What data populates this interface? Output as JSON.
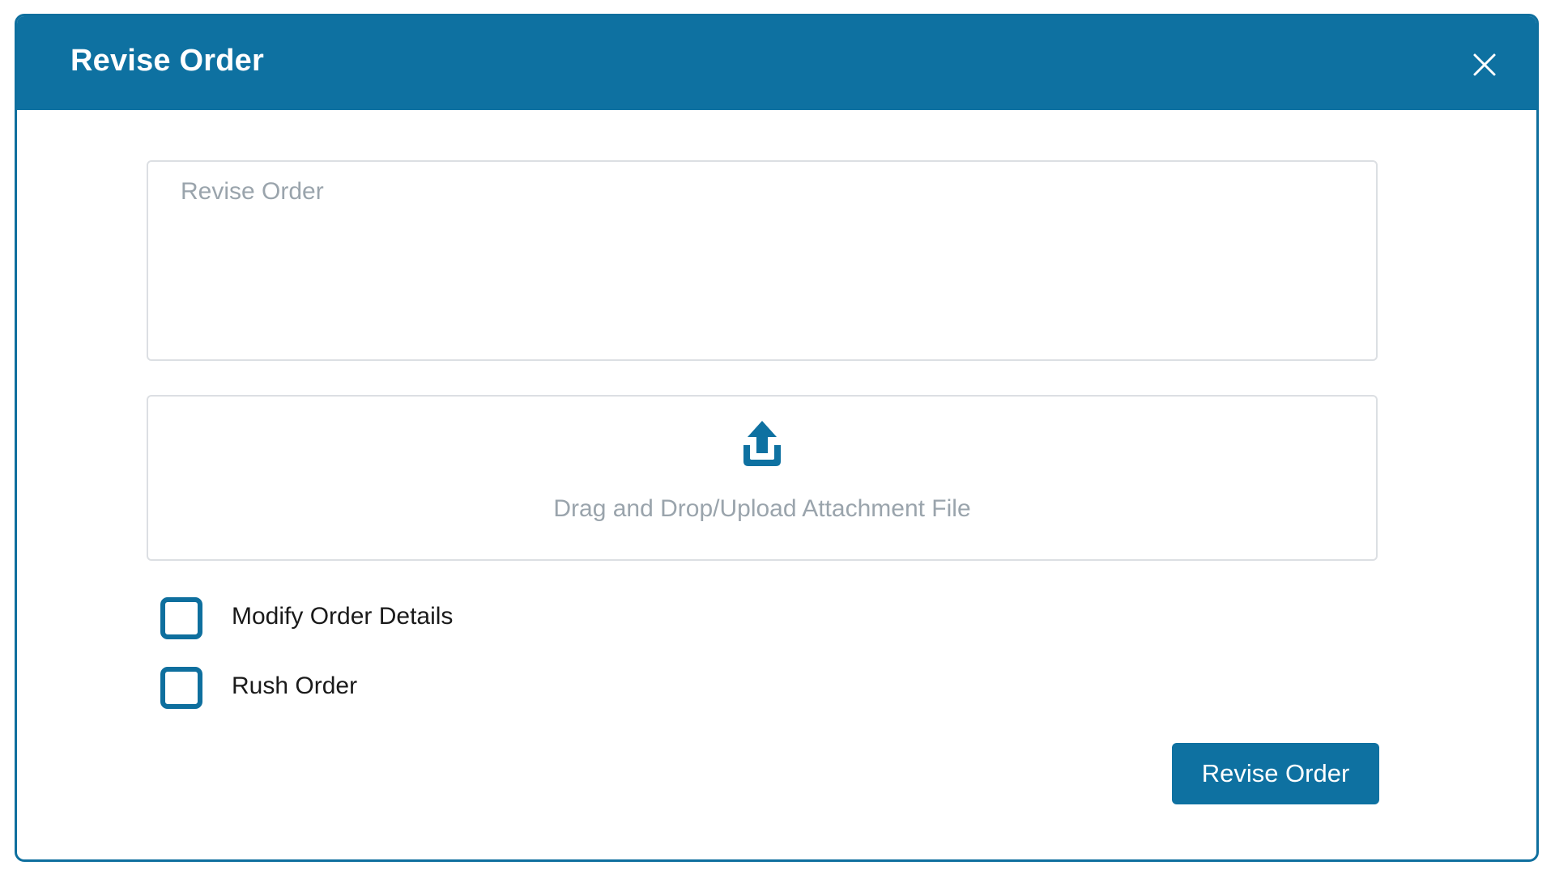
{
  "dialog": {
    "title": "Revise Order",
    "close_icon": "close-icon"
  },
  "revise_field": {
    "placeholder": "Revise Order",
    "value": ""
  },
  "upload": {
    "icon": "upload-icon",
    "label": "Drag and Drop/Upload Attachment File"
  },
  "options": [
    {
      "label": "Modify Order Details",
      "checked": false
    },
    {
      "label": "Rush Order",
      "checked": false
    }
  ],
  "submit": {
    "label": "Revise Order"
  },
  "colors": {
    "accent": "#0e71a1",
    "border": "#dcdfe3",
    "placeholder_text": "#9aa4ac"
  }
}
